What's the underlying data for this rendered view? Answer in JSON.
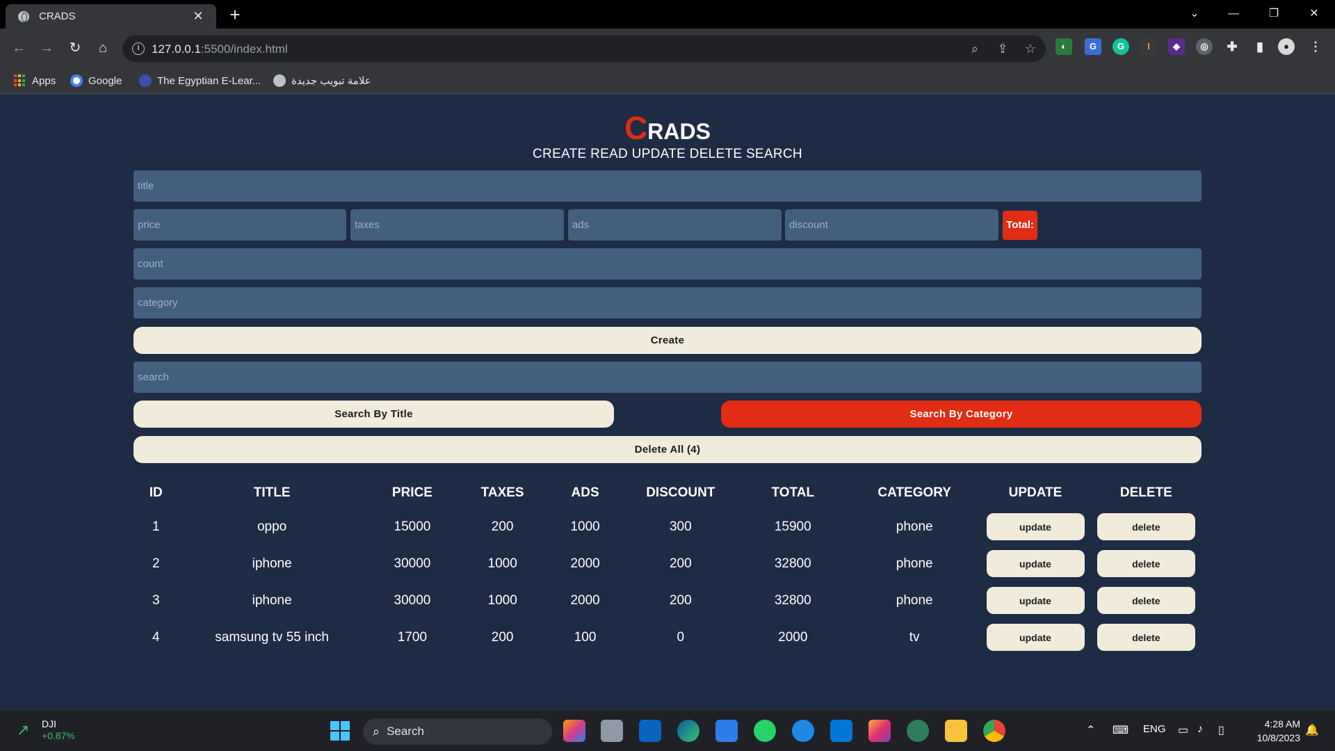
{
  "browser": {
    "tab_title": "CRADS",
    "url_host": "127.0.0.1",
    "url_path": ":5500/index.html",
    "bookmarks": [
      "Apps",
      "Google",
      "The Egyptian E-Lear...",
      "علامة تبويب جديدة"
    ]
  },
  "app": {
    "brand_first": "C",
    "brand_rest": "RADS",
    "subtitle": "CREATE READ UPDATE DELETE SEARCH",
    "colors": {
      "background": "#1e2b44",
      "input": "#425f7e",
      "accent": "#e02d13",
      "button": "#f1ebdc"
    }
  },
  "form": {
    "title_placeholder": "title",
    "price_placeholder": "price",
    "taxes_placeholder": "taxes",
    "ads_placeholder": "ads",
    "discount_placeholder": "discount",
    "total_label": "Total:",
    "count_placeholder": "count",
    "category_placeholder": "category",
    "create_label": "Create",
    "search_placeholder": "search",
    "search_title_label": "Search By Title",
    "search_category_label": "Search By Category",
    "delete_all_label": "Delete All (4)"
  },
  "table": {
    "headers": [
      "ID",
      "TITLE",
      "PRICE",
      "TAXES",
      "ADS",
      "DISCOUNT",
      "TOTAL",
      "CATEGORY",
      "UPDATE",
      "DELETE"
    ],
    "update_label": "update",
    "delete_label": "delete",
    "rows": [
      {
        "id": "1",
        "title": "oppo",
        "price": "15000",
        "taxes": "200",
        "ads": "1000",
        "discount": "300",
        "total": "15900",
        "category": "phone"
      },
      {
        "id": "2",
        "title": "iphone",
        "price": "30000",
        "taxes": "1000",
        "ads": "2000",
        "discount": "200",
        "total": "32800",
        "category": "phone"
      },
      {
        "id": "3",
        "title": "iphone",
        "price": "30000",
        "taxes": "1000",
        "ads": "2000",
        "discount": "200",
        "total": "32800",
        "category": "phone"
      },
      {
        "id": "4",
        "title": "samsung tv 55 inch",
        "price": "1700",
        "taxes": "200",
        "ads": "100",
        "discount": "0",
        "total": "2000",
        "category": "tv"
      }
    ]
  },
  "taskbar": {
    "widget_name": "DJI",
    "widget_change": "+0.87%",
    "search_label": "Search",
    "language": "ENG",
    "time": "4:28 AM",
    "date": "10/8/2023"
  }
}
